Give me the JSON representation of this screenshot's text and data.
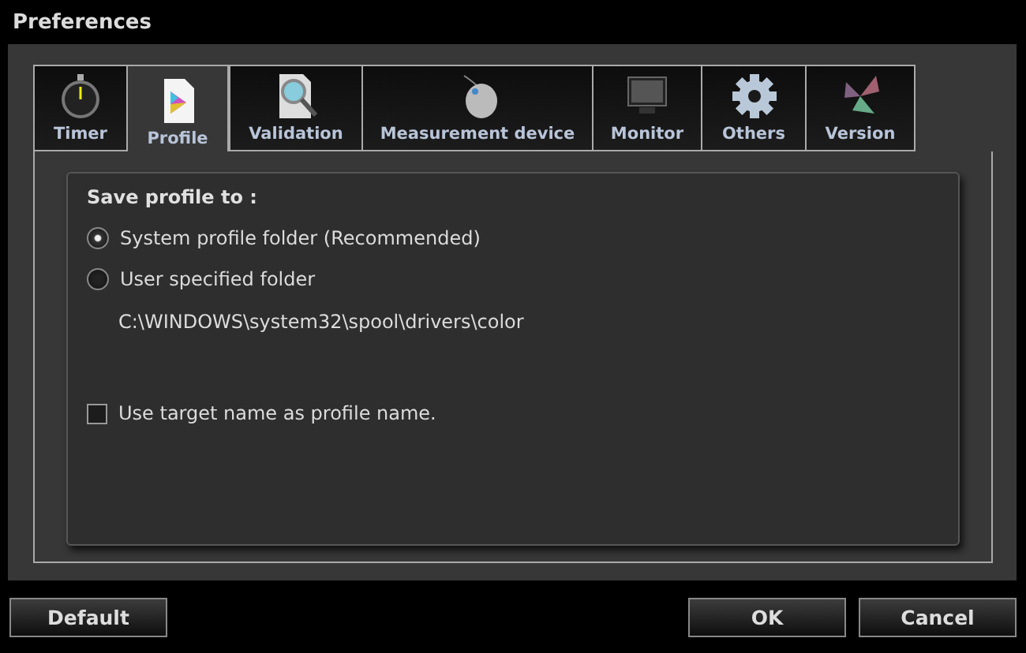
{
  "window": {
    "title": "Preferences"
  },
  "tabs": [
    {
      "label": "Timer",
      "selected": false
    },
    {
      "label": "Profile",
      "selected": true
    },
    {
      "label": "Validation",
      "selected": false
    },
    {
      "label": "Measurement device",
      "selected": false
    },
    {
      "label": "Monitor",
      "selected": false
    },
    {
      "label": "Others",
      "selected": false
    },
    {
      "label": "Version",
      "selected": false
    }
  ],
  "section": {
    "title": "Save profile to :",
    "options": [
      {
        "label": "System profile folder (Recommended)",
        "selected": true
      },
      {
        "label": "User specified folder",
        "selected": false
      }
    ],
    "path": "C:\\WINDOWS\\system32\\spool\\drivers\\color",
    "checkbox": {
      "label": "Use target name as profile name.",
      "checked": false
    }
  },
  "buttons": {
    "left": [
      "Default"
    ],
    "right": [
      "OK",
      "Cancel"
    ]
  }
}
